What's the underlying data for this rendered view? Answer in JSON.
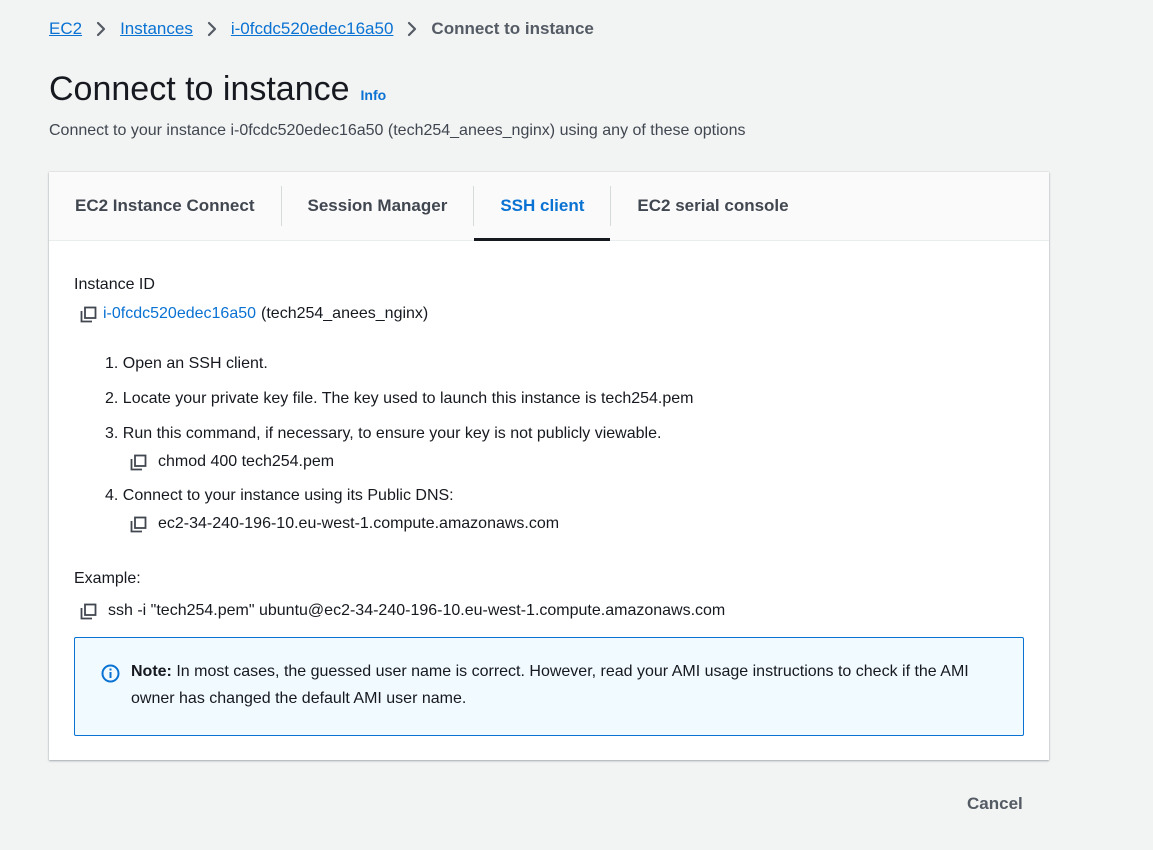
{
  "breadcrumb": {
    "items": [
      "EC2",
      "Instances",
      "i-0fcdc520edec16a50"
    ],
    "current": "Connect to instance"
  },
  "page": {
    "title": "Connect to instance",
    "info_label": "Info",
    "subtitle": "Connect to your instance i-0fcdc520edec16a50 (tech254_anees_nginx) using any of these options"
  },
  "tabs": [
    {
      "label": "EC2 Instance Connect",
      "active": false
    },
    {
      "label": "Session Manager",
      "active": false
    },
    {
      "label": "SSH client",
      "active": true
    },
    {
      "label": "EC2 serial console",
      "active": false
    }
  ],
  "instance": {
    "label": "Instance ID",
    "id": "i-0fcdc520edec16a50",
    "name": "(tech254_anees_nginx)"
  },
  "steps": {
    "s1": "1. Open an SSH client.",
    "s2": "2. Locate your private key file. The key used to launch this instance is tech254.pem",
    "s3": "3. Run this command, if necessary, to ensure your key is not publicly viewable.",
    "s3_command": "chmod 400 tech254.pem",
    "s4": "4. Connect to your instance using its Public DNS:",
    "s4_dns": "ec2-34-240-196-10.eu-west-1.compute.amazonaws.com"
  },
  "example": {
    "label": "Example:",
    "command": "ssh -i \"tech254.pem\" ubuntu@ec2-34-240-196-10.eu-west-1.compute.amazonaws.com"
  },
  "note": {
    "bold": "Note:",
    "text": "In most cases, the guessed user name is correct. However, read your AMI usage instructions to check if the AMI owner has changed the default AMI user name."
  },
  "footer": {
    "cancel_label": "Cancel"
  },
  "colors": {
    "link": "#0972d3",
    "background": "#f2f3f3",
    "note_bg": "#f1faff"
  }
}
